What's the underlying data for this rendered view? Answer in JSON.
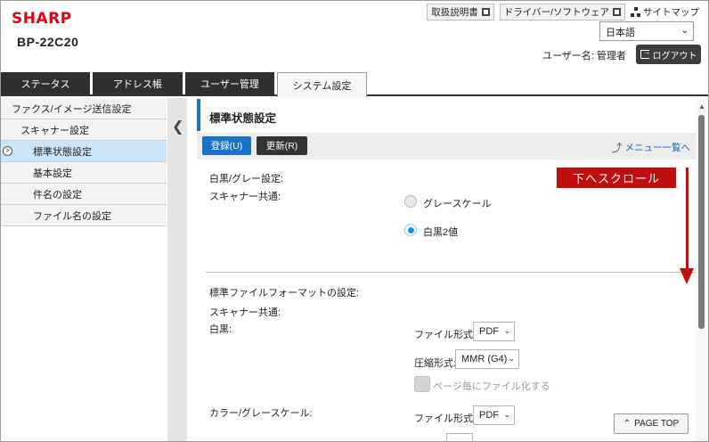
{
  "header": {
    "brand": "SHARP",
    "model": "BP-22C20",
    "links": {
      "manual": "取扱説明書",
      "driver": "ドライバー/ソフトウェア",
      "sitemap": "サイトマップ"
    },
    "language": "日本語",
    "user_label": "ユーザー名: 管理者",
    "logout": "ログアウト"
  },
  "tabs": [
    "ステータス",
    "アドレス帳",
    "ユーザー管理",
    "システム設定"
  ],
  "sidebar": {
    "items": [
      {
        "label": "ファクス/イメージ送信設定"
      },
      {
        "label": "スキャナー設定"
      },
      {
        "label": "標準状態設定"
      },
      {
        "label": "基本設定"
      },
      {
        "label": "件名の設定"
      },
      {
        "label": "ファイル名の設定"
      }
    ]
  },
  "main": {
    "title": "標準状態設定",
    "save": "登録(U)",
    "refresh": "更新(R)",
    "menu_link": "メニュー一覧へ",
    "bw_gray_label": "白黒/グレー設定:",
    "scanner_common": "スキャナー共通:",
    "radio_gray": "グレースケール",
    "radio_bw": "白黒2値",
    "format_label": "標準ファイルフォーマットの設定:",
    "scanner_common2": "スキャナー共通:",
    "bw": "白黒:",
    "file_type_label": "ファイル形式:",
    "file_type_value": "PDF",
    "compression_label": "圧縮形式:",
    "compression_value": "MMR (G4)",
    "per_page": "ページ毎にファイル化する",
    "color_gray": "カラー/グレースケール:",
    "file_type_label2": "ファイル形式:",
    "file_type_value2": "PDF"
  },
  "overlay": {
    "scroll_hint": "下へスクロール"
  },
  "page_top": "PAGE TOP",
  "colors": {
    "brand": "#e3000f",
    "accent": "#1a73c8",
    "hint": "#c00d0d"
  }
}
